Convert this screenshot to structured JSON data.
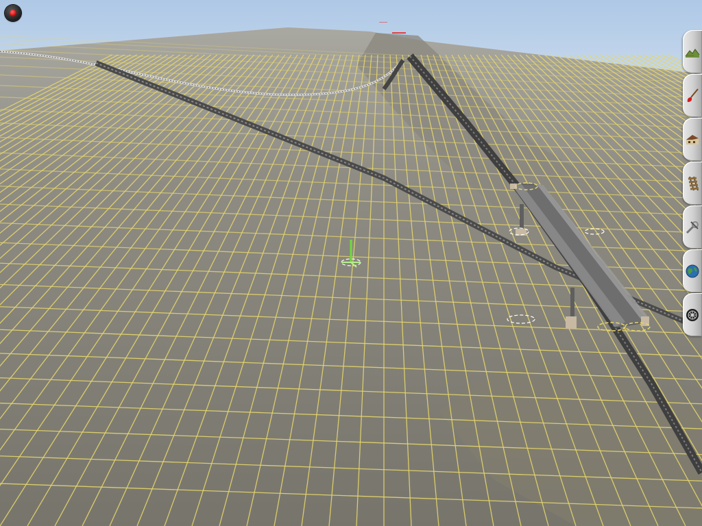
{
  "scene": {
    "type": "3d-terrain-editor",
    "sky_color": "#b7cfe8",
    "terrain_color": "#7d7a6f",
    "grid_color": "#e6d56a",
    "track_color": "#4a4a4a",
    "bridge_color": "#777777"
  },
  "controls": {
    "record": {
      "icon": "record-icon",
      "color": "#d40000"
    }
  },
  "tool_palette": {
    "tools": [
      {
        "id": "terrain",
        "icon": "terrain-icon"
      },
      {
        "id": "paint",
        "icon": "paint-brush-icon"
      },
      {
        "id": "objects",
        "icon": "house-icon"
      },
      {
        "id": "track",
        "icon": "track-icon"
      },
      {
        "id": "tools",
        "icon": "wrench-icon"
      },
      {
        "id": "topology",
        "icon": "globe-icon"
      },
      {
        "id": "session",
        "icon": "wheel-icon"
      }
    ]
  }
}
